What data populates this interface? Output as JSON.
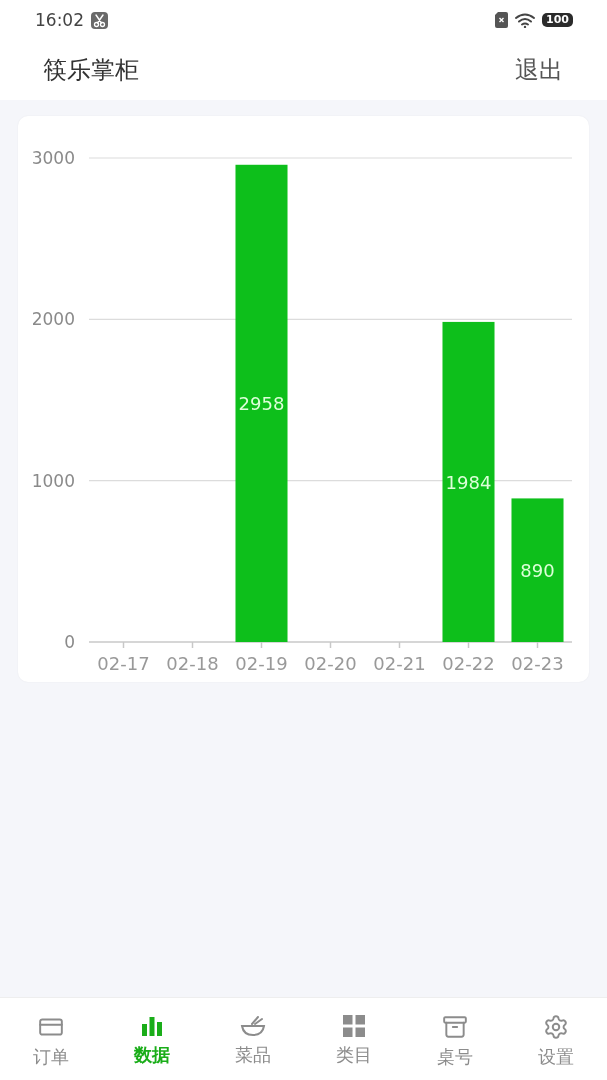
{
  "status_bar": {
    "time": "16:02",
    "battery": "100"
  },
  "header": {
    "title": "筷乐掌柜",
    "action": "退出"
  },
  "chart": {
    "chart_data": {
      "type": "bar",
      "categories": [
        "02-17",
        "02-18",
        "02-19",
        "02-20",
        "02-21",
        "02-22",
        "02-23"
      ],
      "values": [
        0,
        0,
        2958,
        0,
        0,
        1984,
        890
      ],
      "ylim": [
        0,
        3000
      ],
      "yticks": [
        0,
        1000,
        2000,
        3000
      ],
      "value_labels": [
        null,
        null,
        "2958",
        null,
        null,
        "1984",
        "890"
      ]
    }
  },
  "nav": {
    "tabs": [
      {
        "label": "订单",
        "selected": false
      },
      {
        "label": "数据",
        "selected": true
      },
      {
        "label": "菜品",
        "selected": false
      },
      {
        "label": "类目",
        "selected": false
      },
      {
        "label": "桌号",
        "selected": false
      },
      {
        "label": "设置",
        "selected": false
      }
    ]
  }
}
